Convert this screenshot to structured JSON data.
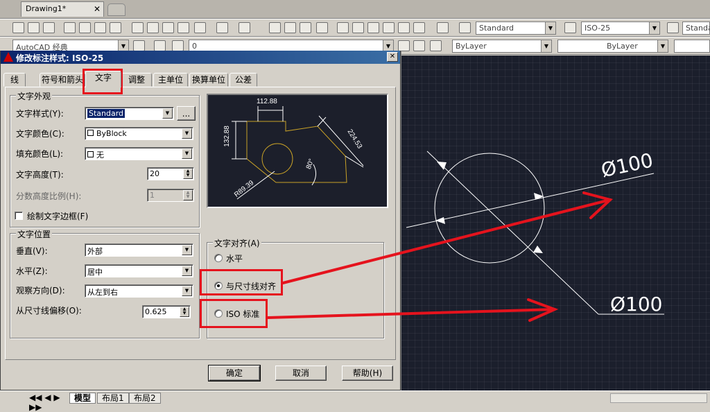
{
  "document_tab": {
    "title": "Drawing1*",
    "close": "✕"
  },
  "toolbar": {
    "text_style_combo": "Standard",
    "dim_style_combo": "ISO-25",
    "table_style_combo": "Standa",
    "workspace_combo": "AutoCAD 经典",
    "layer_combo": "0",
    "color_combo": "ByLayer",
    "linetype_combo": "ByLayer"
  },
  "dialog": {
    "title": "修改标注样式: ISO-25",
    "close": "✕",
    "tabs": [
      "线",
      "符号和箭头",
      "文字",
      "调整",
      "主单位",
      "换算单位",
      "公差"
    ],
    "active_tab": "文字",
    "text_appearance": {
      "group_label": "文字外观",
      "text_style_label": "文字样式(Y):",
      "text_style_value": "Standard",
      "text_style_browse": "...",
      "text_color_label": "文字颜色(C):",
      "text_color_value": "ByBlock",
      "fill_color_label": "填充颜色(L):",
      "fill_color_value": "无",
      "text_height_label": "文字高度(T):",
      "text_height_value": "20",
      "fraction_scale_label": "分数高度比例(H):",
      "fraction_scale_value": "1",
      "draw_frame_label": "绘制文字边框(F)"
    },
    "text_placement": {
      "group_label": "文字位置",
      "vertical_label": "垂直(V):",
      "vertical_value": "外部",
      "horizontal_label": "水平(Z):",
      "horizontal_value": "居中",
      "view_direction_label": "观察方向(D):",
      "view_direction_value": "从左到右",
      "offset_label": "从尺寸线偏移(O):",
      "offset_value": "0.625"
    },
    "text_alignment": {
      "group_label": "文字对齐(A)",
      "options": [
        "水平",
        "与尺寸线对齐",
        "ISO 标准"
      ],
      "selected": "与尺寸线对齐"
    },
    "preview": {
      "dim_top": "112.88",
      "dim_left": "132.88",
      "dim_right": "224.53",
      "dim_angle": "80°",
      "dim_radius": "R89.39"
    },
    "buttons": {
      "ok": "确定",
      "cancel": "取消",
      "help": "帮助(H)"
    }
  },
  "drawing": {
    "label_upper": "Ø100",
    "label_lower": "Ø100"
  },
  "layout_tabs": [
    "模型",
    "布局1",
    "布局2"
  ],
  "colors": {
    "annotation_red": "#e5131d",
    "canvas_bg": "#1b1f2c",
    "title_blue": "#0a246a"
  }
}
